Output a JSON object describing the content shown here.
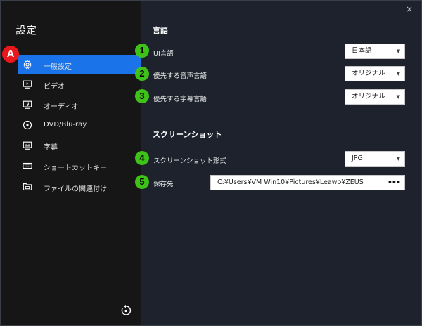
{
  "window": {
    "close_label": "×"
  },
  "sidebar": {
    "title": "設定",
    "items": [
      {
        "label": "一般設定",
        "icon": "gear-icon",
        "active": true
      },
      {
        "label": "ビデオ",
        "icon": "video-icon"
      },
      {
        "label": "オーディオ",
        "icon": "audio-icon"
      },
      {
        "label": "DVD/Blu-ray",
        "icon": "disc-icon"
      },
      {
        "label": "字幕",
        "icon": "subtitle-icon"
      },
      {
        "label": "ショートカットキー",
        "icon": "keyboard-icon"
      },
      {
        "label": "ファイルの関連付け",
        "icon": "folder-icon"
      }
    ],
    "reset_icon": "reset-icon"
  },
  "annotations": {
    "sidebar_badge": "A",
    "badges": [
      "1",
      "2",
      "3",
      "4",
      "5"
    ]
  },
  "language": {
    "title": "言語",
    "ui_language_label": "UI言語",
    "ui_language_value": "日本語",
    "audio_language_label": "優先する音声言語",
    "audio_language_value": "オリジナル",
    "subtitle_language_label": "優先する字幕言語",
    "subtitle_language_value": "オリジナル"
  },
  "screenshot": {
    "title": "スクリーンショット",
    "format_label": "スクリーンショット形式",
    "format_value": "JPG",
    "save_label": "保存先",
    "save_path": "C:¥Users¥VM Win10¥Pictures¥Leawo¥ZEUS",
    "more_label": "•••"
  },
  "colors": {
    "sidebar_bg": "#161616",
    "content_bg": "#1d222d",
    "accent": "#1a73e8",
    "badge_green": "#3ec21a",
    "badge_red": "#e8181c"
  }
}
